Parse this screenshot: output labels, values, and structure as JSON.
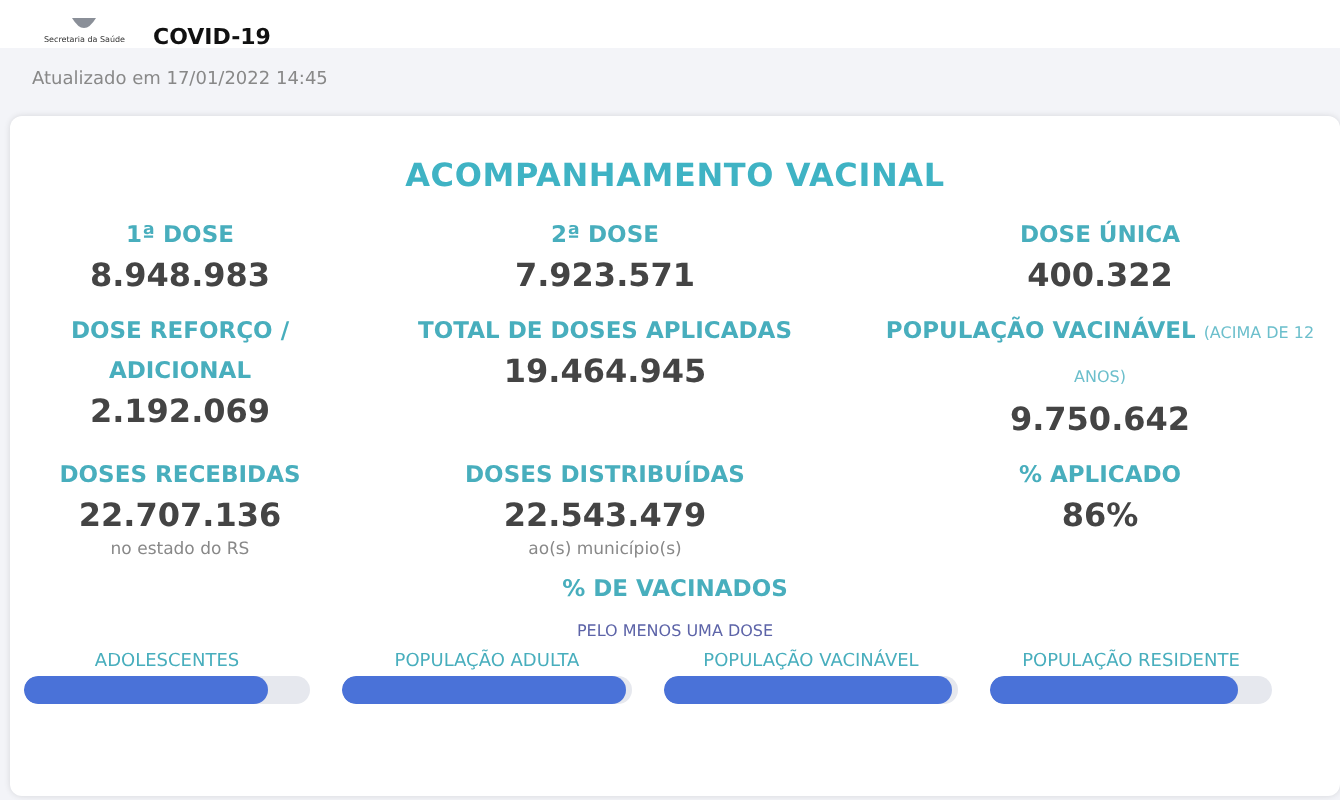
{
  "header": {
    "logo_caption": "Secretaria da Saúde",
    "title": "COVID-19"
  },
  "updated": "Atualizado em 17/01/2022 14:45",
  "card": {
    "title": "ACOMPANHAMENTO VACINAL",
    "stats": [
      {
        "label": "1ª DOSE",
        "value": "8.948.983"
      },
      {
        "label": "2ª DOSE",
        "value": "7.923.571"
      },
      {
        "label": "DOSE ÚNICA",
        "value": "400.322"
      },
      {
        "label": "DOSE REFORÇO / ADICIONAL",
        "value": "2.192.069"
      },
      {
        "label": "TOTAL DE DOSES APLICADAS",
        "value": "19.464.945"
      },
      {
        "label": "POPULAÇÃO VACINÁVEL",
        "note": "(ACIMA DE 12 ANOS)",
        "value": "9.750.642"
      },
      {
        "label": "DOSES RECEBIDAS",
        "value": "22.707.136",
        "sub": "no estado do RS"
      },
      {
        "label": "DOSES DISTRIBUÍDAS",
        "value": "22.543.479",
        "sub": "ao(s) município(s)"
      },
      {
        "label": "% APLICADO",
        "value": "86%"
      }
    ],
    "vaccinated": {
      "title": "% DE VACINADOS",
      "subtitle": "PELO MENOS UMA DOSE",
      "bars": [
        {
          "label": "ADOLESCENTES",
          "level": 0.85
        },
        {
          "label": "POPULAÇÃO ADULTA",
          "level": 0.98
        },
        {
          "label": "POPULAÇÃO VACINÁVEL",
          "level": 0.98
        },
        {
          "label": "POPULAÇÃO RESIDENTE",
          "level": 0.88
        }
      ]
    }
  }
}
